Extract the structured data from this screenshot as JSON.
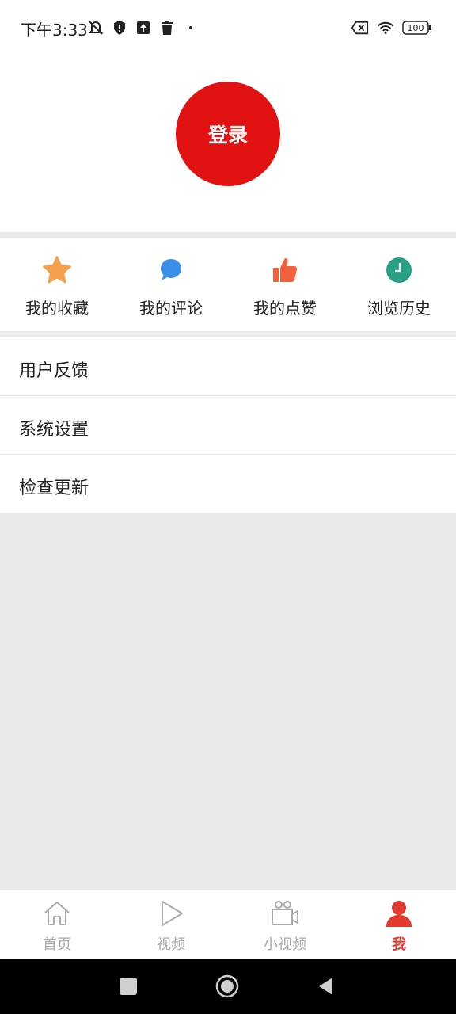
{
  "status_bar": {
    "time": "下午3:33",
    "battery": "100",
    "icons_left": [
      "mute-icon",
      "shield-icon",
      "upload-icon",
      "trash-icon",
      "dot-icon"
    ],
    "icons_right": [
      "sim-off-icon",
      "wifi-icon",
      "battery-icon"
    ]
  },
  "header": {
    "login_label": "登录",
    "accent_color": "#e31212"
  },
  "quick_actions": [
    {
      "label": "我的收藏",
      "icon": "star-icon",
      "color": "#f5a04a"
    },
    {
      "label": "我的评论",
      "icon": "comment-icon",
      "color": "#3b8fe8"
    },
    {
      "label": "我的点赞",
      "icon": "thumbs-up-icon",
      "color": "#f2603e"
    },
    {
      "label": "浏览历史",
      "icon": "clock-icon",
      "color": "#27a085"
    }
  ],
  "menu": [
    {
      "label": "用户反馈"
    },
    {
      "label": "系统设置"
    },
    {
      "label": "检查更新"
    }
  ],
  "tabs": [
    {
      "label": "首页",
      "icon": "home-icon",
      "active": false
    },
    {
      "label": "视频",
      "icon": "play-icon",
      "active": false
    },
    {
      "label": "小视频",
      "icon": "camera-icon",
      "active": false
    },
    {
      "label": "我",
      "icon": "person-icon",
      "active": true
    }
  ],
  "colors": {
    "tab_active": "#e23a2e",
    "tab_inactive": "#aaaaaa",
    "background": "#e9eaec"
  }
}
